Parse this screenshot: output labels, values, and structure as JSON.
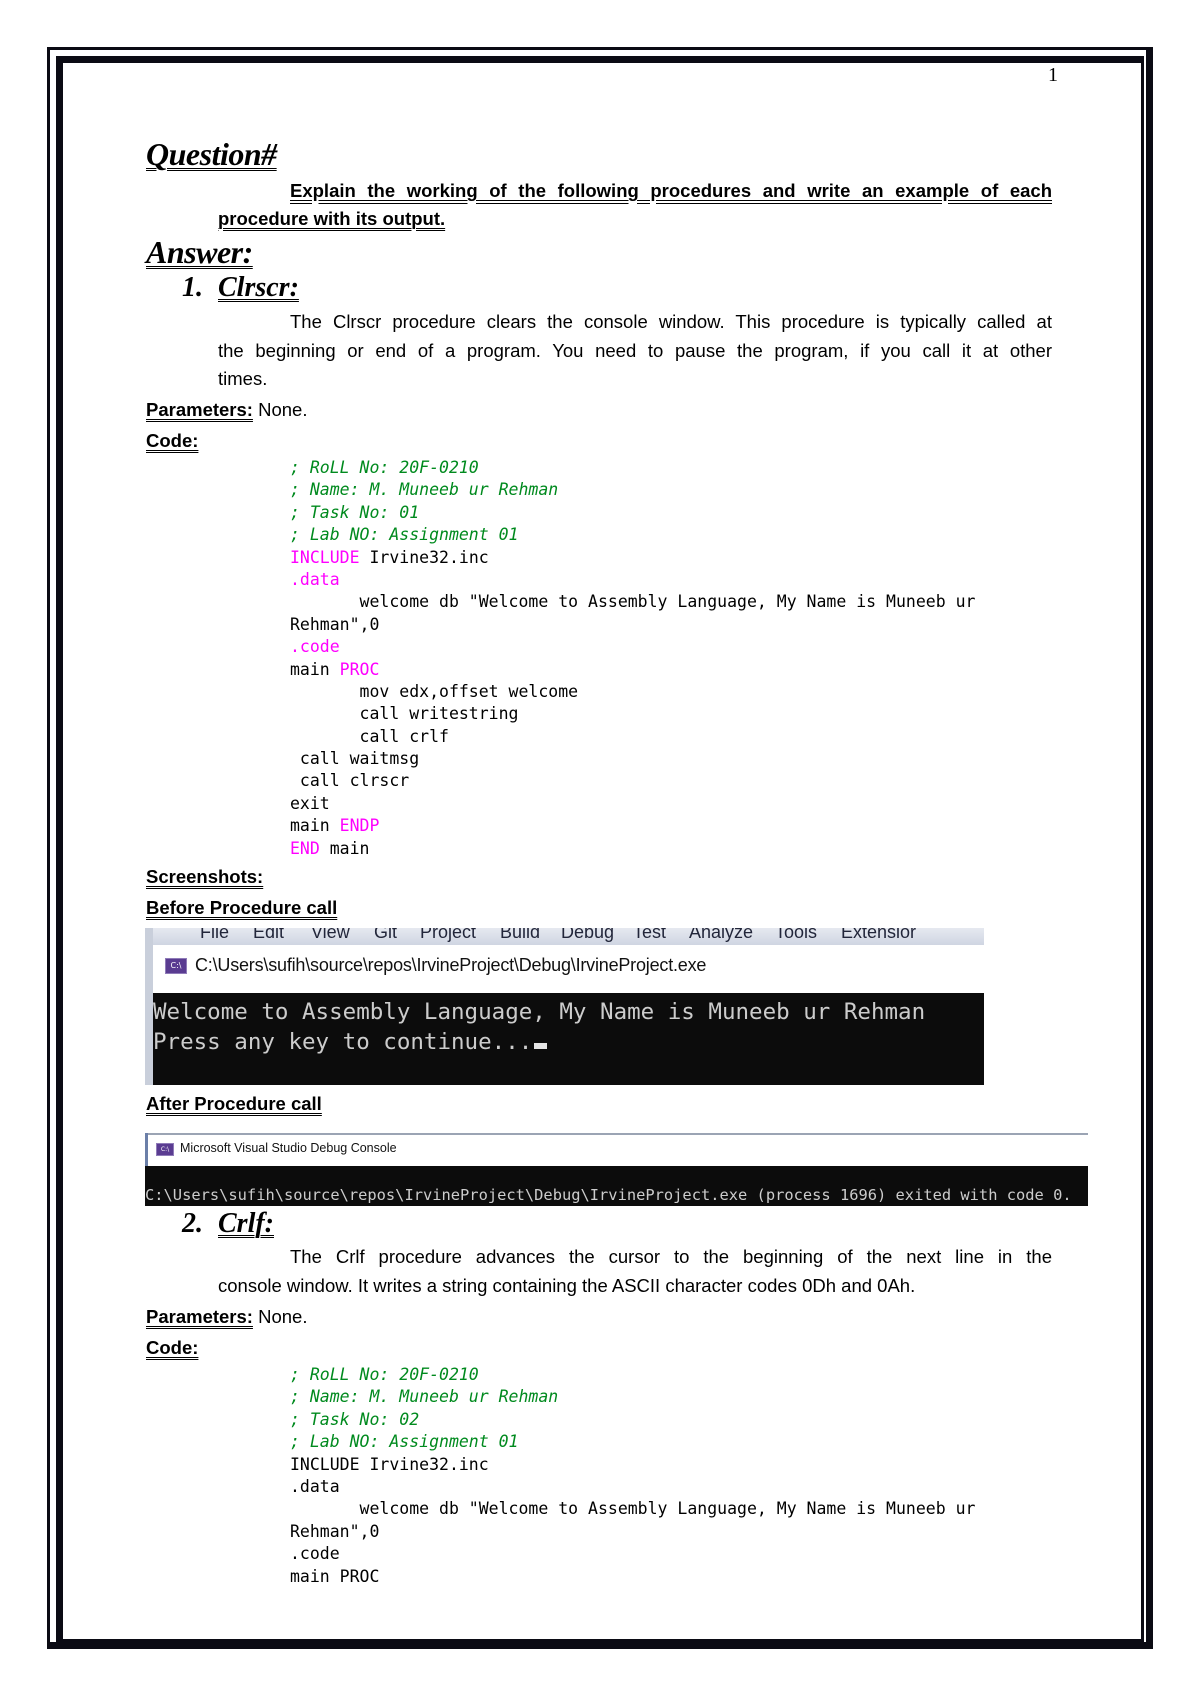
{
  "page_number": "1",
  "question": {
    "heading": "Question#",
    "text_line1": "Explain the working of the following procedures and write an example of each",
    "text_line2": "procedure with its output."
  },
  "answer": {
    "heading": "Answer:"
  },
  "labels": {
    "parameters": "Parameters:",
    "code": "Code:",
    "screenshots": "Screenshots:",
    "before_call": "Before Procedure call",
    "after_call": "After Procedure call"
  },
  "sections": [
    {
      "number": "1.",
      "title": "Clrscr:",
      "description_lines": [
        "The Clrscr procedure clears the console window. This procedure is typically called at",
        "the beginning or end of a program. You need to pause the program, if you call it at other",
        "times."
      ],
      "parameters_value": "None.",
      "code": [
        {
          "type": "comment",
          "text": "; RoLL No: 20F-0210"
        },
        {
          "type": "comment",
          "text": "; Name: M. Muneeb ur Rehman"
        },
        {
          "type": "comment",
          "text": "; Task No: 01"
        },
        {
          "type": "comment",
          "text": "; Lab NO: Assignment 01"
        },
        {
          "type": "mixed",
          "kw": "INCLUDE",
          "rest": " Irvine32.inc"
        },
        {
          "type": "keyword",
          "text": ".data"
        },
        {
          "type": "plain",
          "text": "       welcome db \"Welcome to Assembly Language, My Name is Muneeb ur"
        },
        {
          "type": "plain",
          "text": "Rehman\",0"
        },
        {
          "type": "keyword",
          "text": ".code"
        },
        {
          "type": "mixed-after",
          "pre": "main ",
          "kw": "PROC"
        },
        {
          "type": "plain",
          "text": "       mov edx,offset welcome"
        },
        {
          "type": "plain",
          "text": "       call writestring"
        },
        {
          "type": "plain",
          "text": "       call crlf"
        },
        {
          "type": "plain",
          "text": " call waitmsg"
        },
        {
          "type": "plain",
          "text": " call clrscr"
        },
        {
          "type": "plain",
          "text": "exit"
        },
        {
          "type": "mixed-after",
          "pre": "main ",
          "kw": "ENDP"
        },
        {
          "type": "mixed",
          "kw": "END",
          "rest": " main"
        }
      ],
      "screenshot_before": {
        "menu_items": [
          "File",
          "Edit",
          "View",
          "Git",
          "Project",
          "Build",
          "Debug",
          "Test",
          "Analyze",
          "Tools",
          "Extensior"
        ],
        "window_title": "C:\\Users\\sufih\\source\\repos\\IrvineProject\\Debug\\IrvineProject.exe",
        "console_lines": [
          "Welcome to Assembly Language, My Name is Muneeb ur Rehman",
          "Press any key to continue..."
        ],
        "icon_label": "C:\\"
      },
      "screenshot_after": {
        "window_title": "Microsoft Visual Studio Debug Console",
        "console_line": "C:\\Users\\sufih\\source\\repos\\IrvineProject\\Debug\\IrvineProject.exe (process 1696) exited with code 0.",
        "icon_label": "C:\\"
      }
    },
    {
      "number": "2.",
      "title": "Crlf:",
      "description_lines": [
        "The Crlf procedure advances the cursor to the beginning of the next line in the",
        "console window. It writes a string containing the ASCII character codes 0Dh and 0Ah."
      ],
      "parameters_value": "None.",
      "code": [
        {
          "type": "comment",
          "text": "; RoLL No: 20F-0210"
        },
        {
          "type": "comment",
          "text": "; Name: M. Muneeb ur Rehman"
        },
        {
          "type": "comment",
          "text": "; Task No: 02"
        },
        {
          "type": "comment",
          "text": "; Lab NO: Assignment 01"
        },
        {
          "type": "plain",
          "text": "INCLUDE Irvine32.inc"
        },
        {
          "type": "plain",
          "text": ".data"
        },
        {
          "type": "plain",
          "text": "       welcome db \"Welcome to Assembly Language, My Name is Muneeb ur"
        },
        {
          "type": "plain",
          "text": "Rehman\",0"
        },
        {
          "type": "plain",
          "text": ".code"
        },
        {
          "type": "plain",
          "text": "main PROC"
        }
      ]
    }
  ],
  "colors": {
    "comment": "#008a1e",
    "keyword": "#ff00ff",
    "console_bg": "#0c0c0c",
    "console_fg": "#cccccc",
    "frame": "#0b0b14"
  }
}
